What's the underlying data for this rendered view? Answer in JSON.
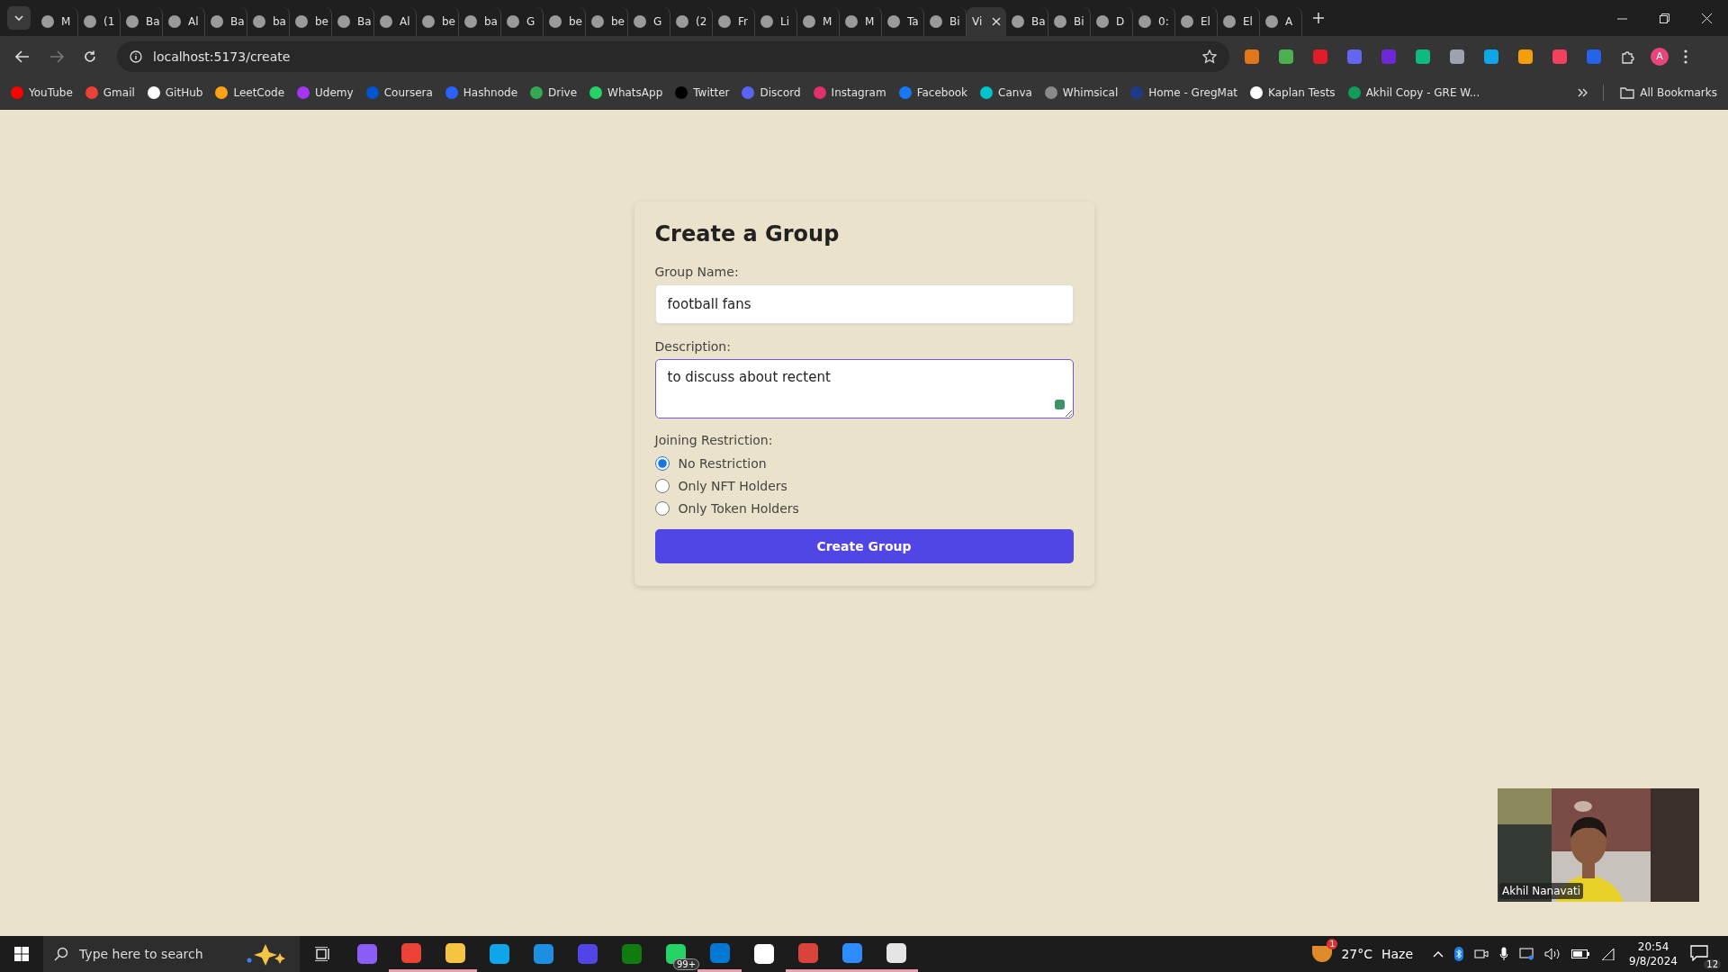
{
  "browser": {
    "tabs": [
      {
        "label": "M",
        "selected": false
      },
      {
        "label": "(1",
        "selected": false
      },
      {
        "label": "Ba",
        "selected": false
      },
      {
        "label": "Al",
        "selected": false
      },
      {
        "label": "Ba",
        "selected": false
      },
      {
        "label": "ba",
        "selected": false
      },
      {
        "label": "be",
        "selected": false
      },
      {
        "label": "Ba",
        "selected": false
      },
      {
        "label": "Al",
        "selected": false
      },
      {
        "label": "be",
        "selected": false
      },
      {
        "label": "ba",
        "selected": false
      },
      {
        "label": "G",
        "selected": false
      },
      {
        "label": "be",
        "selected": false
      },
      {
        "label": "be",
        "selected": false
      },
      {
        "label": "G",
        "selected": false
      },
      {
        "label": "(2",
        "selected": false
      },
      {
        "label": "Fr",
        "selected": false
      },
      {
        "label": "Li",
        "selected": false
      },
      {
        "label": "M",
        "selected": false
      },
      {
        "label": "M",
        "selected": false
      },
      {
        "label": "Ta",
        "selected": false
      },
      {
        "label": "Bi",
        "selected": false
      },
      {
        "label": "Vi",
        "selected": true
      },
      {
        "label": "Ba",
        "selected": false
      },
      {
        "label": "Bi",
        "selected": false
      },
      {
        "label": "D",
        "selected": false
      },
      {
        "label": "0:",
        "selected": false
      },
      {
        "label": "El",
        "selected": false
      },
      {
        "label": "El",
        "selected": false
      },
      {
        "label": "A",
        "selected": false
      }
    ],
    "address": "localhost:5173/create",
    "extensions": [
      {
        "color": "#e2761b"
      },
      {
        "color": "#4caf50"
      },
      {
        "color": "#e11d2a"
      },
      {
        "color": "#6366f1"
      },
      {
        "color": "#6d28d9"
      },
      {
        "color": "#10b981"
      },
      {
        "color": "#9ca3af"
      },
      {
        "color": "#0ea5e9"
      },
      {
        "color": "#f59e0b"
      },
      {
        "color": "#f43f5e"
      },
      {
        "color": "#2563eb"
      }
    ],
    "profile": "A",
    "bookmarks": [
      {
        "label": "YouTube",
        "color": "#ff0000"
      },
      {
        "label": "Gmail",
        "color": "#ea4335"
      },
      {
        "label": "GitHub",
        "color": "#ffffff"
      },
      {
        "label": "LeetCode",
        "color": "#ffa116"
      },
      {
        "label": "Udemy",
        "color": "#a435f0"
      },
      {
        "label": "Coursera",
        "color": "#0056d2"
      },
      {
        "label": "Hashnode",
        "color": "#2962ff"
      },
      {
        "label": "Drive",
        "color": "#34a853"
      },
      {
        "label": "WhatsApp",
        "color": "#25d366"
      },
      {
        "label": "Twitter",
        "color": "#000000"
      },
      {
        "label": "Discord",
        "color": "#5865f2"
      },
      {
        "label": "Instagram",
        "color": "#e1306c"
      },
      {
        "label": "Facebook",
        "color": "#1877f2"
      },
      {
        "label": "Canva",
        "color": "#00c4cc"
      },
      {
        "label": "Whimsical",
        "color": "#8a8a8a"
      },
      {
        "label": "Home - GregMat",
        "color": "#1e3a8a"
      },
      {
        "label": "Kaplan Tests",
        "color": "#ffffff"
      },
      {
        "label": "Akhil Copy - GRE W...",
        "color": "#0f9d58"
      }
    ],
    "all_bookmarks": "All Bookmarks"
  },
  "form": {
    "title": "Create a Group",
    "name_label": "Group Name:",
    "name_value": "football fans",
    "description_label": "Description:",
    "description_value": "to discuss about rectent",
    "restriction_label": "Joining Restriction:",
    "options": [
      {
        "label": "No Restriction",
        "selected": true
      },
      {
        "label": "Only NFT Holders",
        "selected": false
      },
      {
        "label": "Only Token Holders",
        "selected": false
      }
    ],
    "submit": "Create Group"
  },
  "video": {
    "kind": "picture",
    "name": "Akhil Nanavati"
  },
  "taskbar": {
    "search_placeholder": "Type here to search",
    "apps": [
      {
        "color": "#8b5cf6",
        "running": false
      },
      {
        "color": "#ea4335",
        "running": true
      },
      {
        "color": "#f5c542",
        "running": true
      },
      {
        "color": "#0ea5e9",
        "running": false
      },
      {
        "color": "#1d8fe1",
        "running": false
      },
      {
        "color": "#4f46e5",
        "running": false
      },
      {
        "color": "#107c10",
        "running": false
      },
      {
        "color": "#25d366",
        "running": false,
        "badge": "99+"
      },
      {
        "color": "#0078d4",
        "running": true
      },
      {
        "color": "#ffffff",
        "running": false
      },
      {
        "color": "#d9443a",
        "running": true
      },
      {
        "color": "#2d8cff",
        "running": true
      },
      {
        "color": "#e5e5e5",
        "running": true
      }
    ],
    "weather_badge": "1",
    "temperature": "27°C",
    "condition": "Haze",
    "time": "20:54",
    "date": "9/8/2024",
    "notifications": "12"
  }
}
